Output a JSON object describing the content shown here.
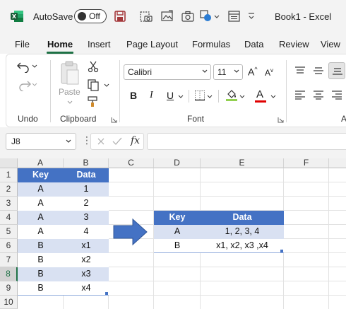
{
  "titlebar": {
    "autosave_label": "AutoSave",
    "autosave_state": "Off",
    "document_title": "Book1 - Excel",
    "icons": [
      "excel-logo-icon",
      "save-icon",
      "camera-icon",
      "image-icon",
      "camera-icon",
      "shapes-icon",
      "form-icon"
    ]
  },
  "tabs": [
    {
      "label": "File",
      "active": false
    },
    {
      "label": "Home",
      "active": true
    },
    {
      "label": "Insert",
      "active": false
    },
    {
      "label": "Page Layout",
      "active": false
    },
    {
      "label": "Formulas",
      "active": false
    },
    {
      "label": "Data",
      "active": false
    },
    {
      "label": "Review",
      "active": false
    },
    {
      "label": "View",
      "active": false
    }
  ],
  "ribbon": {
    "undo_label": "Undo",
    "clipboard_label": "Clipboard",
    "paste_label": "Paste",
    "font_label": "Font",
    "alignment_label_partial": "A",
    "font_name": "Calibri",
    "font_size": "11",
    "bold": "B",
    "italic": "I",
    "underline": "U",
    "grow_font": "A",
    "shrink_font": "A",
    "font_color_letter": "A"
  },
  "formula_bar": {
    "name_box": "J8",
    "fx": "fx",
    "formula": ""
  },
  "grid": {
    "columns": [
      "A",
      "B",
      "C",
      "D",
      "E",
      "F"
    ],
    "rows": [
      "1",
      "2",
      "3",
      "4",
      "5",
      "6",
      "7",
      "8",
      "9",
      "10"
    ],
    "selected_row": "8"
  },
  "source_table": {
    "headers": [
      "Key",
      "Data"
    ],
    "rows": [
      [
        "A",
        "1"
      ],
      [
        "A",
        "2"
      ],
      [
        "A",
        "3"
      ],
      [
        "A",
        "4"
      ],
      [
        "B",
        "x1"
      ],
      [
        "B",
        "x2"
      ],
      [
        "B",
        "x3"
      ],
      [
        "B",
        "x4"
      ]
    ]
  },
  "result_table": {
    "headers": [
      "Key",
      "Data"
    ],
    "rows": [
      [
        "A",
        "1, 2, 3, 4"
      ],
      [
        "B",
        "x1, x2, x3 ,x4"
      ]
    ]
  },
  "colors": {
    "accent": "#1e7145",
    "table_header": "#4472c4",
    "table_band": "#d9e1f2",
    "arrow": "#4472c4"
  }
}
